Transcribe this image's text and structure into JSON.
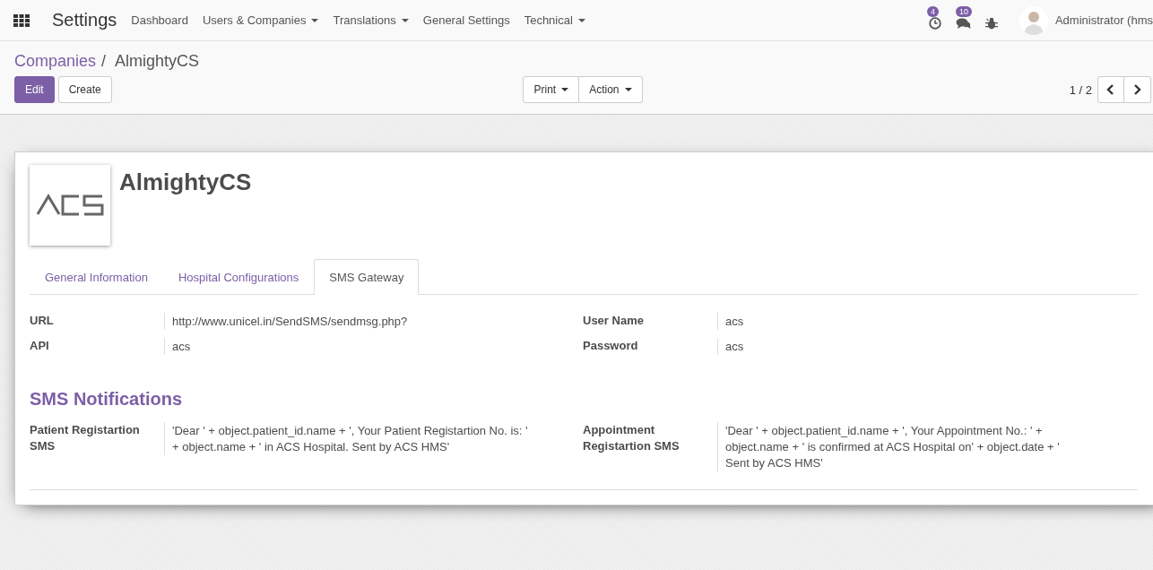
{
  "navbar": {
    "app_title": "Settings",
    "menu": [
      {
        "label": "Dashboard",
        "kind": "link"
      },
      {
        "label": "Users & Companies",
        "kind": "dropdown"
      },
      {
        "label": "Translations",
        "kind": "dropdown"
      },
      {
        "label": "General Settings",
        "kind": "link"
      },
      {
        "label": "Technical",
        "kind": "dropdown"
      }
    ],
    "activity_badge": "4",
    "messages_badge": "10",
    "user_name": "Administrator (hms"
  },
  "breadcrumb": {
    "parent": "Companies",
    "separator": "/",
    "current": "AlmightyCS"
  },
  "buttons": {
    "primary": "Edit",
    "secondary": "Create",
    "print": "Print",
    "action": "Action"
  },
  "pager": {
    "value": "1 / 2"
  },
  "record": {
    "name": "AlmightyCS",
    "tabs": [
      {
        "label": "General Information",
        "selected": false
      },
      {
        "label": "Hospital Configurations",
        "selected": false
      },
      {
        "label": "SMS Gateway",
        "selected": true
      }
    ],
    "fields_left": [
      {
        "label": "URL",
        "value": "http://www.unicel.in/SendSMS/sendmsg.php?"
      },
      {
        "label": "API",
        "value": "acs"
      }
    ],
    "fields_right": [
      {
        "label": "User Name",
        "value": "acs"
      },
      {
        "label": "Password",
        "value": "acs"
      }
    ],
    "section_title": "SMS Notifications",
    "notifications": [
      {
        "label": "Patient Registartion SMS",
        "value": "'Dear ' + object.patient_id.name + ', Your Patient Registartion No. is: ' + object.name + ' in ACS Hospital. Sent by ACS HMS'"
      },
      {
        "label": "Appointment Registartion SMS",
        "value": "'Dear ' + object.patient_id.name + ', Your Appointment No.: ' + object.name + ' is confirmed at ACS Hospital on' + object.date + '  Sent by ACS HMS'"
      }
    ]
  }
}
